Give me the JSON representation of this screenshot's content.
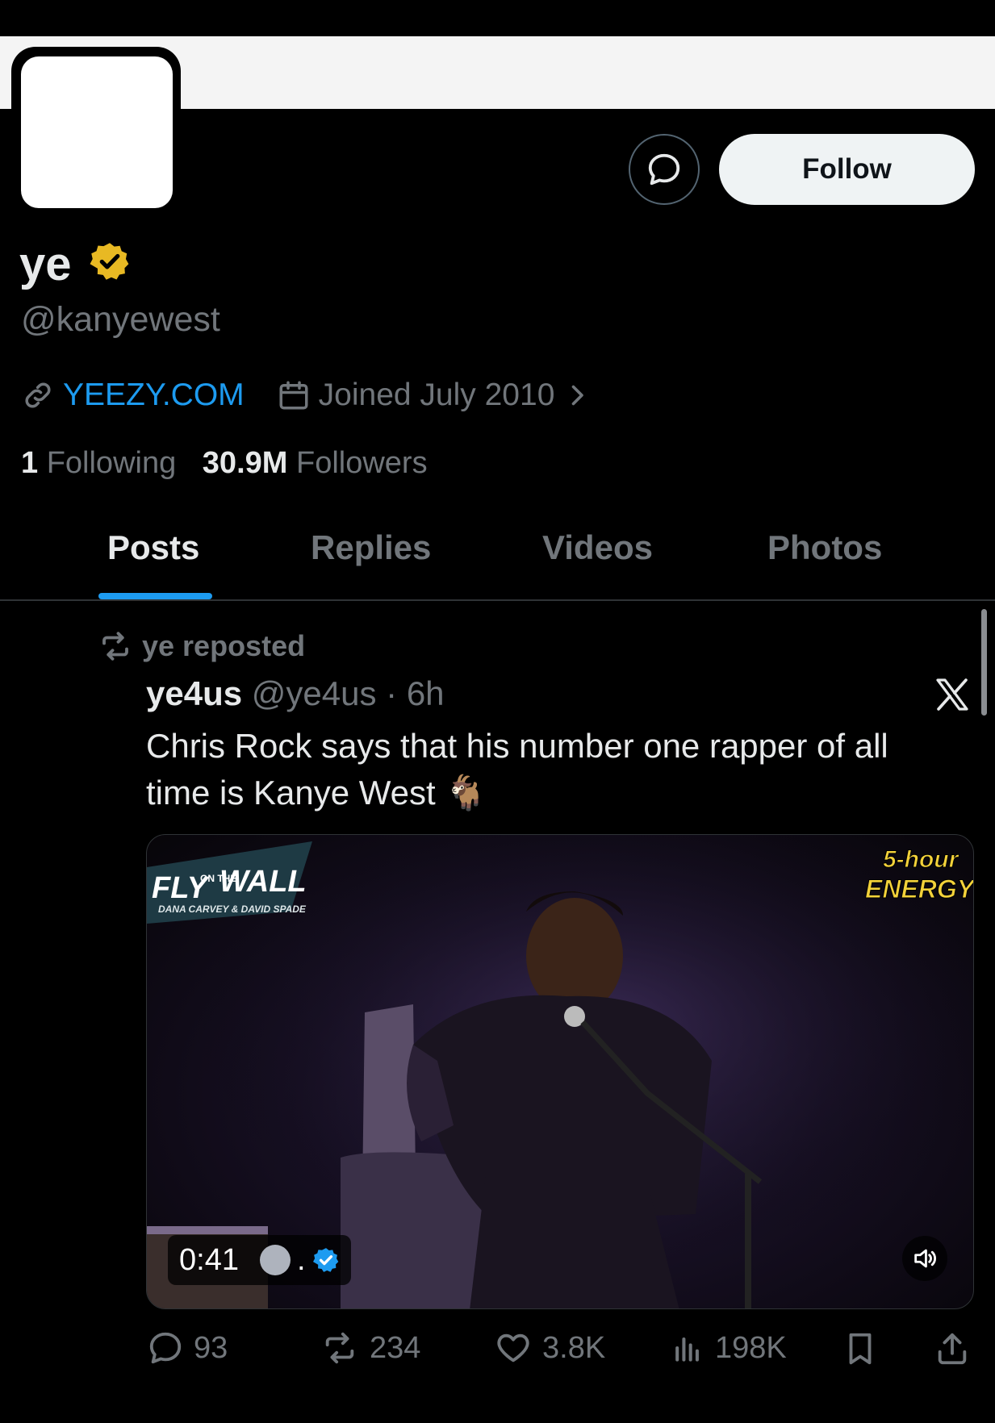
{
  "profile": {
    "follow_label": "Follow",
    "name": "ye",
    "handle": "@kanyewest",
    "website": "YEEZY.COM",
    "joined": "Joined July 2010",
    "following_count": "1",
    "following_label": "Following",
    "followers_count": "30.9M",
    "followers_label": "Followers"
  },
  "tabs": [
    {
      "label": "Posts",
      "active": true
    },
    {
      "label": "Replies",
      "active": false
    },
    {
      "label": "Videos",
      "active": false
    },
    {
      "label": "Photos",
      "active": false
    }
  ],
  "post": {
    "repost_label": "ye reposted",
    "author_name": "ye4us",
    "author_handle": "@ye4us",
    "time": "6h",
    "text": "Chris Rock says that his number one rapper of all time is Kanye West 🐐",
    "media": {
      "show_logo_fly": "FLY",
      "show_logo_onthe": "ON THE",
      "show_logo_wall": "WALL",
      "show_logo_hosts": "DANA CARVEY & DAVID SPADE",
      "sponsor_top": "5-hour",
      "sponsor_bottom": "ENERGY",
      "duration": "0:41",
      "duration_suffix": "."
    },
    "stats": {
      "replies": "93",
      "reposts": "234",
      "likes": "3.8K",
      "views": "198K"
    }
  },
  "colors": {
    "accent": "#1d9bf0",
    "verified_gold": "#e8b923",
    "muted": "#71767b",
    "background": "#000000"
  },
  "icons": [
    "message-icon",
    "verified-gold-icon",
    "link-icon",
    "calendar-icon",
    "chevron-right-icon",
    "repost-icon",
    "x-logo-icon",
    "verified-blue-icon",
    "speaker-icon",
    "reply-icon",
    "like-icon",
    "views-icon",
    "bookmark-icon",
    "share-icon"
  ]
}
